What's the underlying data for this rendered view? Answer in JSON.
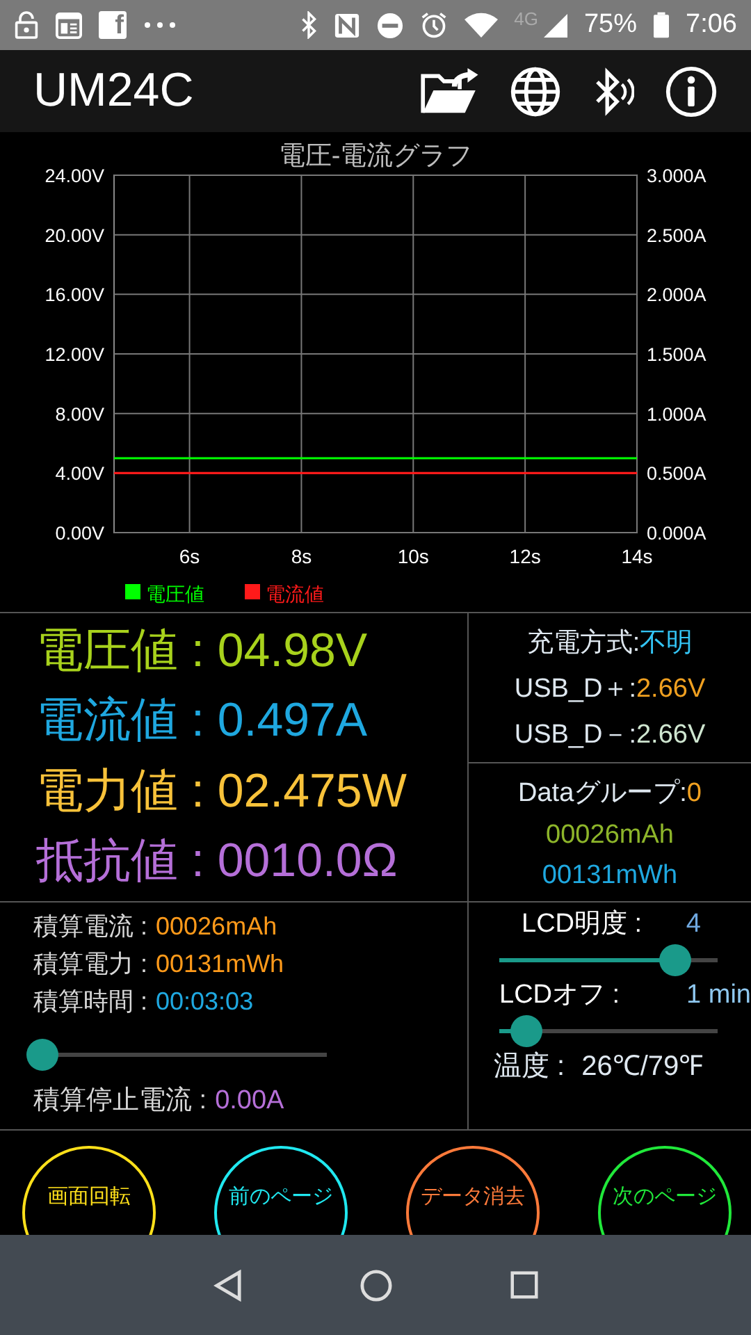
{
  "status_bar": {
    "notification_glyph": "f",
    "network": "4G",
    "battery": "75%",
    "time": "7:06"
  },
  "app_bar": {
    "title": "UM24C"
  },
  "chart": {
    "chart_data": {
      "type": "line",
      "title": "電圧-電流グラフ",
      "grid": true,
      "legend": "bottom",
      "x": [
        4.65,
        14
      ],
      "xlim": [
        4.65,
        14
      ],
      "ylim": [
        0,
        24
      ],
      "y2lim": [
        0,
        3
      ],
      "xticks": [
        {
          "value": 6,
          "label": "6s"
        },
        {
          "value": 8,
          "label": "8s"
        },
        {
          "value": 10,
          "label": "10s"
        },
        {
          "value": 12,
          "label": "12s"
        },
        {
          "value": 14,
          "label": "14s"
        }
      ],
      "yticks": [
        {
          "value": 0,
          "label": "0.00V"
        },
        {
          "value": 4,
          "label": "4.00V"
        },
        {
          "value": 8,
          "label": "8.00V"
        },
        {
          "value": 12,
          "label": "12.00V"
        },
        {
          "value": 16,
          "label": "16.00V"
        },
        {
          "value": 20,
          "label": "20.00V"
        },
        {
          "value": 24,
          "label": "24.00V"
        }
      ],
      "y2ticks": [
        {
          "value": 0,
          "label": "0.000A"
        },
        {
          "value": 0.5,
          "label": "0.500A"
        },
        {
          "value": 1,
          "label": "1.000A"
        },
        {
          "value": 1.5,
          "label": "1.500A"
        },
        {
          "value": 2,
          "label": "2.000A"
        },
        {
          "value": 2.5,
          "label": "2.500A"
        },
        {
          "value": 3,
          "label": "3.000A"
        }
      ],
      "series": [
        {
          "name": "電圧値",
          "color": "#00ff00",
          "values": [
            5,
            5
          ]
        },
        {
          "name": "電流値",
          "color": "#ff1a1a",
          "axis": "y2",
          "values": [
            0.5,
            0.5
          ]
        }
      ]
    }
  },
  "readings": [
    {
      "text": "電圧値 : 04.98V",
      "color": "#a8d21c"
    },
    {
      "text": "電流値 : 0.497A",
      "color": "#1fa8e0"
    },
    {
      "text": "電力値 : 02.475W",
      "color": "#f8c23a"
    },
    {
      "text": "抵抗値 : 0010.0Ω",
      "color": "#b56fd8"
    }
  ],
  "port_info": [
    {
      "label": "充電方式:",
      "value": "不明",
      "color": "#33c4f4"
    },
    {
      "label": "USB_D＋:",
      "value": "2.66V",
      "color": "#f0a020"
    },
    {
      "label": "USB_D－:",
      "value": "2.66V",
      "color": "#cfe6d0"
    }
  ],
  "data_group": {
    "label": "Dataグループ:",
    "value": "0",
    "color": "#f0a020",
    "lines": [
      {
        "text": "00026mAh",
        "color": "#8db52a"
      },
      {
        "text": "00131mWh",
        "color": "#1fa8e0"
      }
    ]
  },
  "accumulation": [
    {
      "label": "積算電流 :",
      "value": "00026mAh",
      "color": "#ff9a1a"
    },
    {
      "label": "積算電力 :",
      "value": "00131mWh",
      "color": "#ff9a1a"
    },
    {
      "label": "積算時間 :",
      "value": "00:03:03",
      "color": "#1fa8e0"
    }
  ],
  "accumulation_slider": {
    "level": 0.03
  },
  "stop_current": {
    "label": "積算停止電流 :",
    "value": "0.00A",
    "color": "#b56fd8"
  },
  "display": {
    "brightness": {
      "label": "LCD明度 :",
      "value": "4",
      "color": "#6fa8e0",
      "level": 0.8
    },
    "lcd_off": {
      "label": "LCDオフ :",
      "value": "1 min",
      "color": "#8fc8f0",
      "level": 0.12
    },
    "temperature": {
      "label": "温度 :",
      "value": "26℃/79℉"
    }
  },
  "actions": [
    {
      "label": "画面回転",
      "color": "#ffe01a"
    },
    {
      "label": "前のページ",
      "color": "#20e8f0"
    },
    {
      "label": "データ消去",
      "color": "#ff7a3a"
    },
    {
      "label": "次のページ",
      "color": "#20e83a"
    }
  ]
}
